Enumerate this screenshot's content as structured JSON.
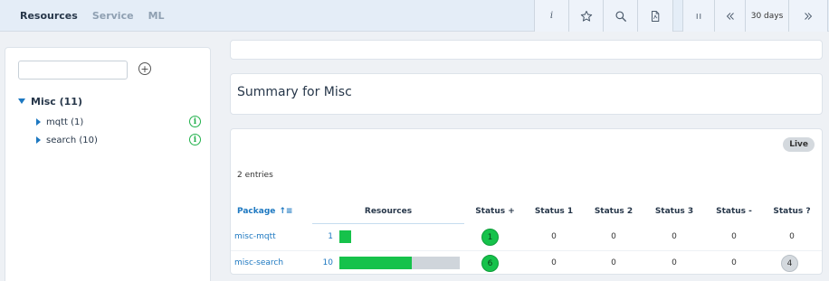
{
  "nav": {
    "tabs": [
      {
        "label": "Resources",
        "active": true
      },
      {
        "label": "Service",
        "active": false
      },
      {
        "label": "ML",
        "active": false
      }
    ]
  },
  "toolbar": {
    "info_label": "i",
    "icons": [
      "info-icon",
      "star-icon",
      "search-icon",
      "pdf-icon"
    ],
    "pause_icon": "pause-icon",
    "back_icon": "double-chevron-left-icon",
    "range_label": "30 days",
    "forward_icon": "double-chevron-right-icon"
  },
  "sidebar": {
    "search": {
      "value": "",
      "placeholder": ""
    },
    "add_label": "+",
    "tree": {
      "root_label": "Misc (11)",
      "children": [
        {
          "label": "mqtt (1)",
          "status_icon": "i"
        },
        {
          "label": "search (10)",
          "status_icon": "i"
        }
      ]
    }
  },
  "summary": {
    "title": "Summary for Misc"
  },
  "table": {
    "live_label": "Live",
    "entries_text": "2 entries",
    "headers": {
      "package": "Package",
      "resources": "Resources",
      "status_plus": "Status +",
      "status_1": "Status 1",
      "status_2": "Status 2",
      "status_3": "Status 3",
      "status_minus": "Status -",
      "status_q": "Status ?"
    },
    "rows": [
      {
        "package": "misc-mqtt",
        "resources": "1",
        "bar_total_fraction": 0.1,
        "bar_green_fraction": 1.0,
        "status_plus": "1",
        "status_1": "0",
        "status_2": "0",
        "status_3": "0",
        "status_minus": "0",
        "status_q": "0"
      },
      {
        "package": "misc-search",
        "resources": "10",
        "bar_total_fraction": 1.0,
        "bar_green_fraction": 0.6,
        "status_plus": "6",
        "status_1": "0",
        "status_2": "0",
        "status_3": "0",
        "status_minus": "0",
        "status_q": "4"
      }
    ]
  },
  "colors": {
    "accent": "#1d78c1",
    "ok_green": "#16c24b",
    "neutral_grey": "#d4d9de"
  }
}
